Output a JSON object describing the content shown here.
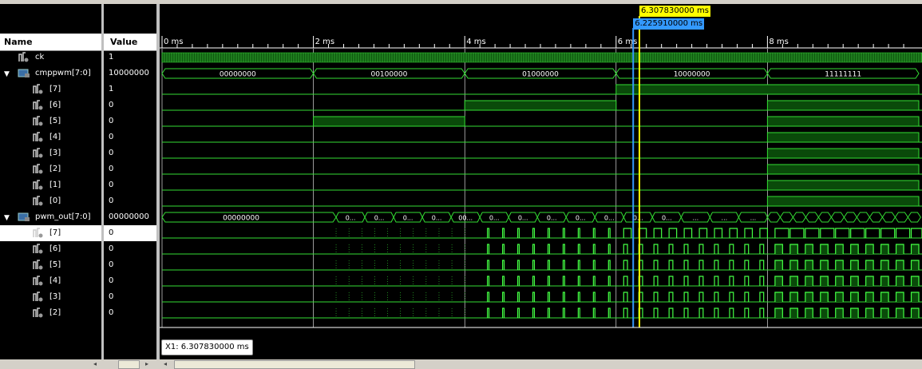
{
  "headers": {
    "name": "Name",
    "value": "Value"
  },
  "time_axis": {
    "unit_ms_labels": [
      "0 ms",
      "2 ms",
      "4 ms",
      "6 ms",
      "8 ms"
    ],
    "label_times": [
      0,
      2,
      4,
      6,
      8
    ],
    "range_ms": [
      0,
      10
    ]
  },
  "cursors": {
    "primary": "6.307830000 ms",
    "secondary": "6.225910000 ms",
    "primary_time": 6.30783,
    "secondary_time": 6.22591
  },
  "cursor_readout": "X1: 6.307830000 ms",
  "signals": [
    {
      "name": "ck",
      "value": "1",
      "kind": "clock",
      "indent": 0
    },
    {
      "name": "cmppwm[7:0]",
      "value": "10000000",
      "kind": "bus",
      "indent": 0,
      "expanded": true,
      "segments": [
        {
          "from": 0,
          "to": 2,
          "label": "00000000"
        },
        {
          "from": 2,
          "to": 4,
          "label": "00100000"
        },
        {
          "from": 4,
          "to": 6,
          "label": "01000000"
        },
        {
          "from": 6,
          "to": 8,
          "label": "10000000"
        },
        {
          "from": 8,
          "to": 10,
          "label": "11111111"
        }
      ]
    },
    {
      "name": "[7]",
      "value": "1",
      "kind": "bit",
      "indent": 1,
      "highs": [
        [
          6,
          10
        ]
      ]
    },
    {
      "name": "[6]",
      "value": "0",
      "kind": "bit",
      "indent": 1,
      "highs": [
        [
          4,
          6
        ],
        [
          8,
          10
        ]
      ]
    },
    {
      "name": "[5]",
      "value": "0",
      "kind": "bit",
      "indent": 1,
      "highs": [
        [
          2,
          4
        ],
        [
          8,
          10
        ]
      ]
    },
    {
      "name": "[4]",
      "value": "0",
      "kind": "bit",
      "indent": 1,
      "highs": [
        [
          8,
          10
        ]
      ]
    },
    {
      "name": "[3]",
      "value": "0",
      "kind": "bit",
      "indent": 1,
      "highs": [
        [
          8,
          10
        ]
      ]
    },
    {
      "name": "[2]",
      "value": "0",
      "kind": "bit",
      "indent": 1,
      "highs": [
        [
          8,
          10
        ]
      ]
    },
    {
      "name": "[1]",
      "value": "0",
      "kind": "bit",
      "indent": 1,
      "highs": [
        [
          8,
          10
        ]
      ]
    },
    {
      "name": "[0]",
      "value": "0",
      "kind": "bit",
      "indent": 1,
      "highs": [
        [
          8,
          10
        ]
      ]
    },
    {
      "name": "pwm_out[7:0]",
      "value": "00000000",
      "kind": "bus2",
      "indent": 0,
      "expanded": true,
      "segments": [
        {
          "from": 0,
          "to": 2.3,
          "label": "00000000"
        }
      ],
      "short_labels": [
        "0...",
        "0...",
        "0...",
        "0...",
        "00...",
        "0...",
        "0...",
        "0...",
        "0...",
        "0...",
        "0...",
        "0...",
        "...",
        "...",
        "..."
      ]
    },
    {
      "name": "[7]",
      "value": "0",
      "kind": "pwm",
      "indent": 1,
      "selected": true
    },
    {
      "name": "[6]",
      "value": "0",
      "kind": "pwm",
      "indent": 1
    },
    {
      "name": "[5]",
      "value": "0",
      "kind": "pwm",
      "indent": 1
    },
    {
      "name": "[4]",
      "value": "0",
      "kind": "pwm",
      "indent": 1
    },
    {
      "name": "[3]",
      "value": "0",
      "kind": "pwm",
      "indent": 1
    },
    {
      "name": "[2]",
      "value": "0",
      "kind": "pwm",
      "indent": 1
    }
  ],
  "colors": {
    "wave": "#33dd33",
    "wave_fill": "#0a4a0a",
    "cursor_primary": "#ffff00",
    "cursor_secondary": "#3399ff",
    "grid": "#ffffff"
  }
}
